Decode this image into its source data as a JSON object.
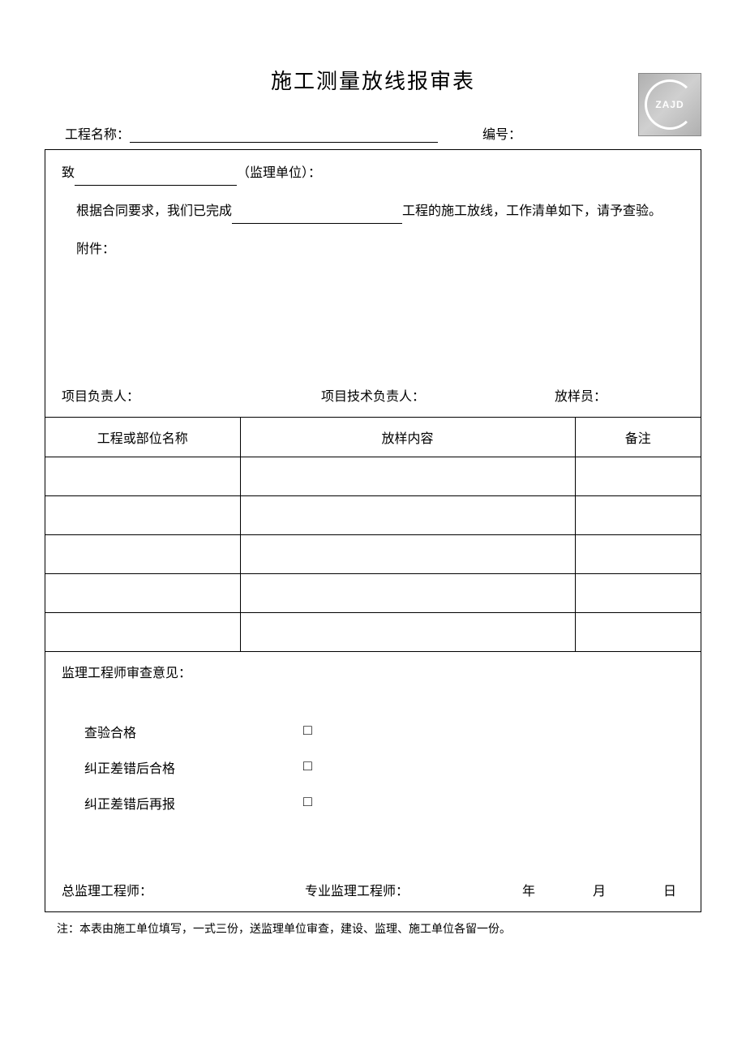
{
  "title": "施工测量放线报审表",
  "logo_text": "ZAJD",
  "header": {
    "project_label": "工程名称：",
    "number_label": "编号："
  },
  "section_top": {
    "to_prefix": "致",
    "to_suffix": "（监理单位）：",
    "body_prefix": "根据合同要求，我们已完成",
    "body_suffix": "工程的施工放线，工作清单如下，请予查验。",
    "attachment": "附件：",
    "sig1": "项目负责人：",
    "sig2": "项目技术负责人：",
    "sig3": "放样员："
  },
  "table": {
    "h1": "工程或部位名称",
    "h2": "放样内容",
    "h3": "备注",
    "rows": [
      {
        "c1": "",
        "c2": "",
        "c3": ""
      },
      {
        "c1": "",
        "c2": "",
        "c3": ""
      },
      {
        "c1": "",
        "c2": "",
        "c3": ""
      },
      {
        "c1": "",
        "c2": "",
        "c3": ""
      },
      {
        "c1": "",
        "c2": "",
        "c3": ""
      }
    ]
  },
  "opinion": {
    "title": "监理工程师审查意见：",
    "opt1": "查验合格",
    "opt2": "纠正差错后合格",
    "opt3": "纠正差错后再报",
    "box": "□",
    "sig1": "总监理工程师：",
    "sig2": "专业监理工程师：",
    "year": "年",
    "month": "月",
    "day": "日"
  },
  "footnote": "注：本表由施工单位填写，一式三份，送监理单位审查，建设、监理、施工单位各留一份。"
}
